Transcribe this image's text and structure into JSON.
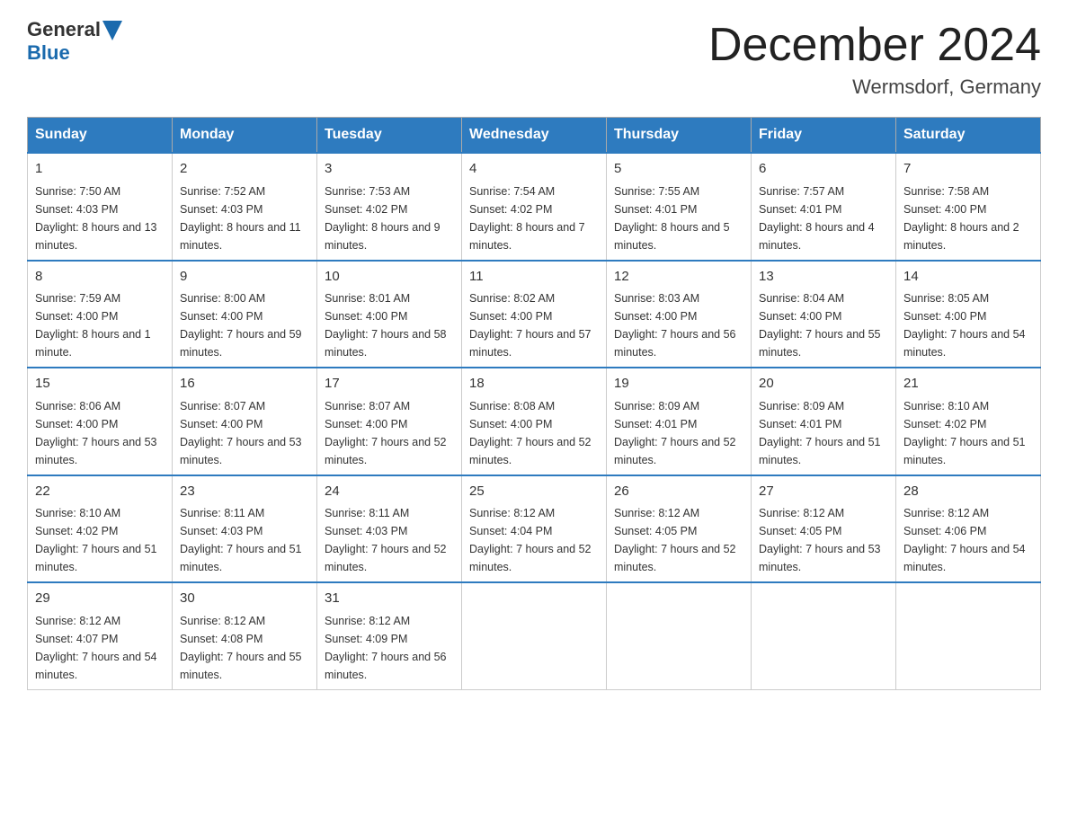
{
  "logo": {
    "general": "General",
    "blue": "Blue"
  },
  "title": "December 2024",
  "location": "Wermsdorf, Germany",
  "days_of_week": [
    "Sunday",
    "Monday",
    "Tuesday",
    "Wednesday",
    "Thursday",
    "Friday",
    "Saturday"
  ],
  "weeks": [
    [
      {
        "day": "1",
        "sunrise": "7:50 AM",
        "sunset": "4:03 PM",
        "daylight": "8 hours and 13 minutes."
      },
      {
        "day": "2",
        "sunrise": "7:52 AM",
        "sunset": "4:03 PM",
        "daylight": "8 hours and 11 minutes."
      },
      {
        "day": "3",
        "sunrise": "7:53 AM",
        "sunset": "4:02 PM",
        "daylight": "8 hours and 9 minutes."
      },
      {
        "day": "4",
        "sunrise": "7:54 AM",
        "sunset": "4:02 PM",
        "daylight": "8 hours and 7 minutes."
      },
      {
        "day": "5",
        "sunrise": "7:55 AM",
        "sunset": "4:01 PM",
        "daylight": "8 hours and 5 minutes."
      },
      {
        "day": "6",
        "sunrise": "7:57 AM",
        "sunset": "4:01 PM",
        "daylight": "8 hours and 4 minutes."
      },
      {
        "day": "7",
        "sunrise": "7:58 AM",
        "sunset": "4:00 PM",
        "daylight": "8 hours and 2 minutes."
      }
    ],
    [
      {
        "day": "8",
        "sunrise": "7:59 AM",
        "sunset": "4:00 PM",
        "daylight": "8 hours and 1 minute."
      },
      {
        "day": "9",
        "sunrise": "8:00 AM",
        "sunset": "4:00 PM",
        "daylight": "7 hours and 59 minutes."
      },
      {
        "day": "10",
        "sunrise": "8:01 AM",
        "sunset": "4:00 PM",
        "daylight": "7 hours and 58 minutes."
      },
      {
        "day": "11",
        "sunrise": "8:02 AM",
        "sunset": "4:00 PM",
        "daylight": "7 hours and 57 minutes."
      },
      {
        "day": "12",
        "sunrise": "8:03 AM",
        "sunset": "4:00 PM",
        "daylight": "7 hours and 56 minutes."
      },
      {
        "day": "13",
        "sunrise": "8:04 AM",
        "sunset": "4:00 PM",
        "daylight": "7 hours and 55 minutes."
      },
      {
        "day": "14",
        "sunrise": "8:05 AM",
        "sunset": "4:00 PM",
        "daylight": "7 hours and 54 minutes."
      }
    ],
    [
      {
        "day": "15",
        "sunrise": "8:06 AM",
        "sunset": "4:00 PM",
        "daylight": "7 hours and 53 minutes."
      },
      {
        "day": "16",
        "sunrise": "8:07 AM",
        "sunset": "4:00 PM",
        "daylight": "7 hours and 53 minutes."
      },
      {
        "day": "17",
        "sunrise": "8:07 AM",
        "sunset": "4:00 PM",
        "daylight": "7 hours and 52 minutes."
      },
      {
        "day": "18",
        "sunrise": "8:08 AM",
        "sunset": "4:00 PM",
        "daylight": "7 hours and 52 minutes."
      },
      {
        "day": "19",
        "sunrise": "8:09 AM",
        "sunset": "4:01 PM",
        "daylight": "7 hours and 52 minutes."
      },
      {
        "day": "20",
        "sunrise": "8:09 AM",
        "sunset": "4:01 PM",
        "daylight": "7 hours and 51 minutes."
      },
      {
        "day": "21",
        "sunrise": "8:10 AM",
        "sunset": "4:02 PM",
        "daylight": "7 hours and 51 minutes."
      }
    ],
    [
      {
        "day": "22",
        "sunrise": "8:10 AM",
        "sunset": "4:02 PM",
        "daylight": "7 hours and 51 minutes."
      },
      {
        "day": "23",
        "sunrise": "8:11 AM",
        "sunset": "4:03 PM",
        "daylight": "7 hours and 51 minutes."
      },
      {
        "day": "24",
        "sunrise": "8:11 AM",
        "sunset": "4:03 PM",
        "daylight": "7 hours and 52 minutes."
      },
      {
        "day": "25",
        "sunrise": "8:12 AM",
        "sunset": "4:04 PM",
        "daylight": "7 hours and 52 minutes."
      },
      {
        "day": "26",
        "sunrise": "8:12 AM",
        "sunset": "4:05 PM",
        "daylight": "7 hours and 52 minutes."
      },
      {
        "day": "27",
        "sunrise": "8:12 AM",
        "sunset": "4:05 PM",
        "daylight": "7 hours and 53 minutes."
      },
      {
        "day": "28",
        "sunrise": "8:12 AM",
        "sunset": "4:06 PM",
        "daylight": "7 hours and 54 minutes."
      }
    ],
    [
      {
        "day": "29",
        "sunrise": "8:12 AM",
        "sunset": "4:07 PM",
        "daylight": "7 hours and 54 minutes."
      },
      {
        "day": "30",
        "sunrise": "8:12 AM",
        "sunset": "4:08 PM",
        "daylight": "7 hours and 55 minutes."
      },
      {
        "day": "31",
        "sunrise": "8:12 AM",
        "sunset": "4:09 PM",
        "daylight": "7 hours and 56 minutes."
      },
      null,
      null,
      null,
      null
    ]
  ]
}
